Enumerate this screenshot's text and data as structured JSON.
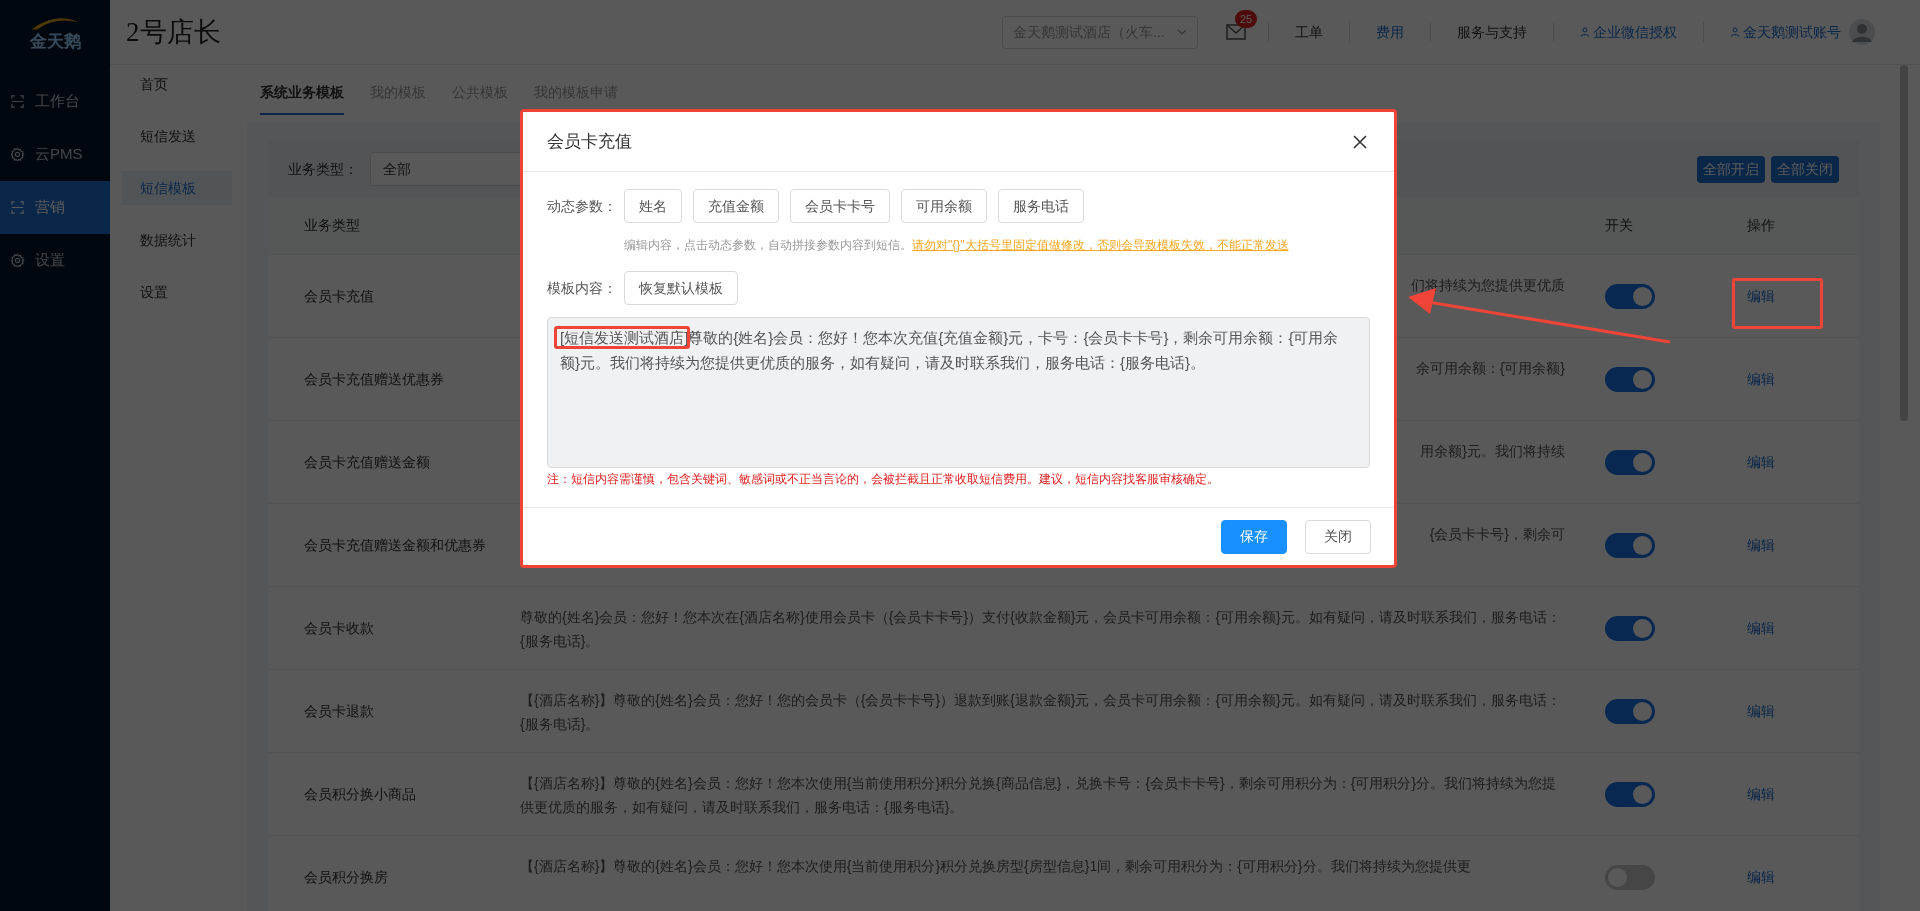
{
  "sidebar": {
    "logo": "金天鹅",
    "items": [
      {
        "label": "工作台",
        "kind": "scan",
        "selected": false
      },
      {
        "label": "云PMS",
        "kind": "gear",
        "selected": false
      },
      {
        "label": "营销",
        "kind": "scan",
        "selected": true
      },
      {
        "label": "设置",
        "kind": "gear",
        "selected": false
      }
    ]
  },
  "header": {
    "title": "2号店长",
    "hotel_select": "金天鹅测试酒店（火车...",
    "mail_badge": "25",
    "links": [
      {
        "label": "工单",
        "kind": "plain"
      },
      {
        "label": "费用",
        "kind": "link"
      },
      {
        "label": "服务与支持",
        "kind": "plain"
      },
      {
        "label": "企业微信授权",
        "kind": "user"
      },
      {
        "label": "金天鹅测试账号",
        "kind": "user"
      }
    ]
  },
  "subnav": [
    {
      "label": "首页",
      "selected": false
    },
    {
      "label": "短信发送",
      "selected": false
    },
    {
      "label": "短信模板",
      "selected": true
    },
    {
      "label": "数据统计",
      "selected": false
    },
    {
      "label": "设置",
      "selected": false
    }
  ],
  "tabs": [
    {
      "label": "系统业务模板",
      "selected": true
    },
    {
      "label": "我的模板",
      "selected": false
    },
    {
      "label": "公共模板",
      "selected": false
    },
    {
      "label": "我的模板申请",
      "selected": false
    }
  ],
  "filter": {
    "label": "业务类型：",
    "value": "全部"
  },
  "bulk_actions": [
    "全部开启",
    "全部关闭"
  ],
  "table": {
    "columns": [
      "业务类型",
      "开关",
      "操作"
    ],
    "rows": [
      {
        "type": "会员卡充值",
        "content": "们将持续为您提供更优质",
        "on": true,
        "action": "编辑"
      },
      {
        "type": "会员卡充值赠送优惠券",
        "content": "余可用余额：{可用余额}",
        "on": true,
        "action": "编辑"
      },
      {
        "type": "会员卡充值赠送金额",
        "content": "用余额}元。我们将持续",
        "on": true,
        "action": "编辑"
      },
      {
        "type": "会员卡充值赠送金额和优惠券",
        "content": "{会员卡卡号}，剩余可",
        "on": true,
        "action": "编辑"
      },
      {
        "type": "会员卡收款",
        "content": "尊敬的{姓名}会员：您好！您本次在{酒店名称}使用会员卡（{会员卡卡号}）支付{收款金额}元，会员卡可用余额：{可用余额}元。如有疑问，请及时联系我们，服务电话：{服务电话}。",
        "on": true,
        "action": "编辑"
      },
      {
        "type": "会员卡退款",
        "content": "【{酒店名称}】尊敬的{姓名}会员：您好！您的会员卡（{会员卡卡号}）退款到账{退款金额}元，会员卡可用余额：{可用余额}元。如有疑问，请及时联系我们，服务电话：{服务电话}。",
        "on": true,
        "action": "编辑"
      },
      {
        "type": "会员积分换小商品",
        "content": "【{酒店名称}】尊敬的{姓名}会员：您好！您本次使用{当前使用积分}积分兑换{商品信息}，兑换卡号：{会员卡卡号}，剩余可用积分为：{可用积分}分。我们将持续为您提供更优质的服务，如有疑问，请及时联系我们，服务电话：{服务电话}。",
        "on": true,
        "action": "编辑"
      },
      {
        "type": "会员积分换房",
        "content": "【{酒店名称}】尊敬的{姓名}会员：您好！您本次使用{当前使用积分}积分兑换房型{房型信息}1间，剩余可用积分为：{可用积分}分。我们将持续为您提供更",
        "on": false,
        "action": "编辑"
      }
    ]
  },
  "dialog": {
    "title": "会员卡充值",
    "param_label": "动态参数：",
    "params": [
      "姓名",
      "充值金额",
      "会员卡卡号",
      "可用余额",
      "服务电话"
    ],
    "hint": "编辑内容，点击动态参数，自动拼接参数内容到短信。",
    "warning": "请勿对\"{}\"大括号里固定值做修改，否则会导致模板失效，不能正常发送",
    "template_label": "模板内容：",
    "restore_button": "恢复默认模板",
    "content": "[短信发送测试酒店]尊敬的{姓名}会员：您好！您本次充值{充值金额}元，卡号：{会员卡卡号}，剩余可用余额：{可用余额}元。我们将持续为您提供更优质的服务，如有疑问，请及时联系我们，服务电话：{服务电话}。",
    "note": "注：短信内容需谨慎，包含关键词、敏感词或不正当言论的，会被拦截且正常收取短信费用。建议，短信内容找客服审核确定。",
    "buttons": [
      {
        "label": "保存",
        "kind": "primary"
      },
      {
        "label": "关闭",
        "kind": "default"
      }
    ]
  }
}
